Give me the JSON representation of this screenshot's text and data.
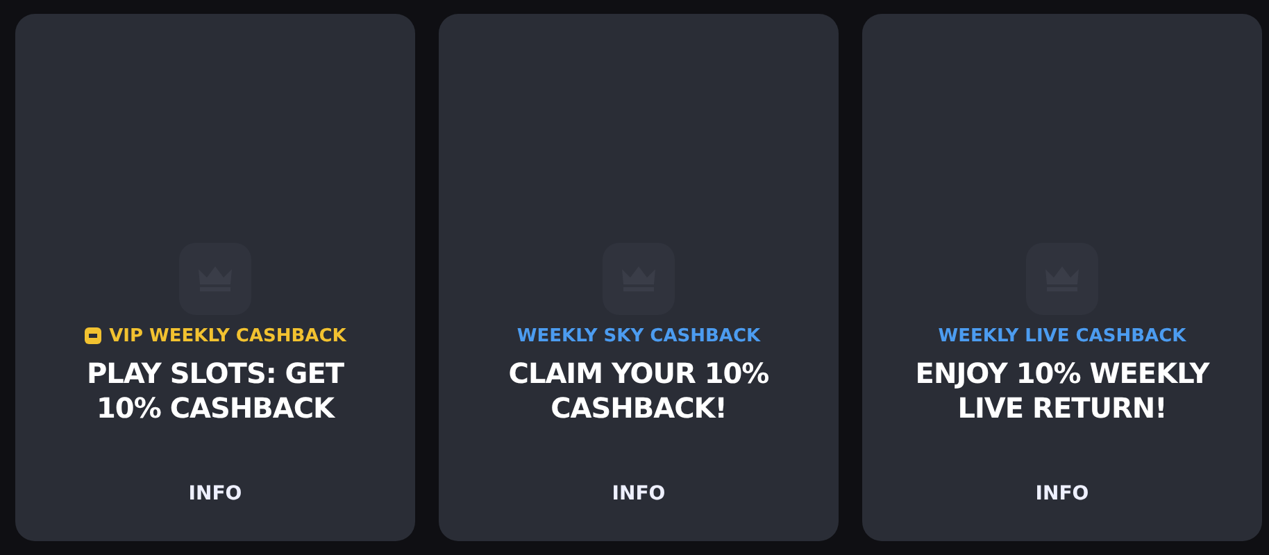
{
  "cards": [
    {
      "tag": {
        "text": "VIP WEEKLY CASHBACK",
        "color": "#f2c230",
        "vip": true
      },
      "title": "PLAY SLOTS: GET 10% CASHBACK",
      "button": "INFO"
    },
    {
      "tag": {
        "text": "WEEKLY SKY CASHBACK",
        "color": "#4c9cf0",
        "vip": false
      },
      "title": "CLAIM YOUR 10% CASHBACK!",
      "button": "INFO"
    },
    {
      "tag": {
        "text": "WEEKLY LIVE CASHBACK",
        "color": "#4c9cf0",
        "vip": false
      },
      "title": "ENJOY 10% WEEKLY LIVE RETURN!",
      "button": "INFO"
    }
  ]
}
